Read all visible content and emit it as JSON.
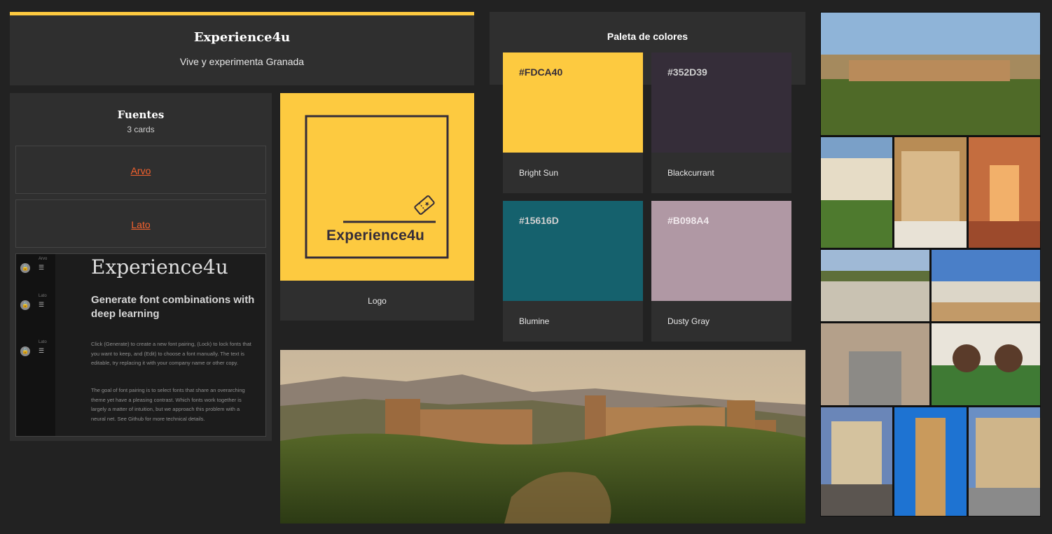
{
  "title_card": {
    "title": "Experience4u",
    "subtitle": "Vive y experimenta Granada"
  },
  "fonts_card": {
    "title": "Fuentes",
    "count": "3 cards",
    "fonts": [
      "Arvo",
      "Lato"
    ],
    "preview": {
      "controls": [
        {
          "label": "Arvo"
        },
        {
          "label": "Lato"
        },
        {
          "label": "Lato"
        }
      ],
      "heading": "Experience4u",
      "subheading": "Generate font combinations with deep learning",
      "paragraph1": "Click (Generate) to create a new font pairing, (Lock) to lock fonts that you want to keep, and (Edit) to choose a font manually. The text is editable, try replacing it with your company name or other copy.",
      "paragraph2": "The goal of font pairing is to select fonts that share an overarching theme yet have a pleasing contrast. Which fonts work together is largely a matter of intuition, but we approach this problem with a neural net. See Github for more technical details."
    }
  },
  "logo_card": {
    "logo_text": "Experience4u",
    "caption": "Logo"
  },
  "palette": {
    "title": "Paleta de colores",
    "colors": [
      {
        "hex": "#FDCA40",
        "name": "Bright Sun",
        "value": "#fdca40",
        "text_color": "#352d39"
      },
      {
        "hex": "#352D39",
        "name": "Blackcurrant",
        "value": "#352d39",
        "text_color": "#cfcfcf"
      },
      {
        "hex": "#15616D",
        "name": "Blumine",
        "value": "#15616d",
        "text_color": "#cfcfcf"
      },
      {
        "hex": "#B098A4",
        "name": "Dusty Gray",
        "value": "#b098a4",
        "text_color": "#f0e8ec"
      }
    ]
  },
  "colors": {
    "background": "#222222",
    "card": "#2f2f2f",
    "accent": "#fdca40",
    "link": "#f4622e"
  }
}
